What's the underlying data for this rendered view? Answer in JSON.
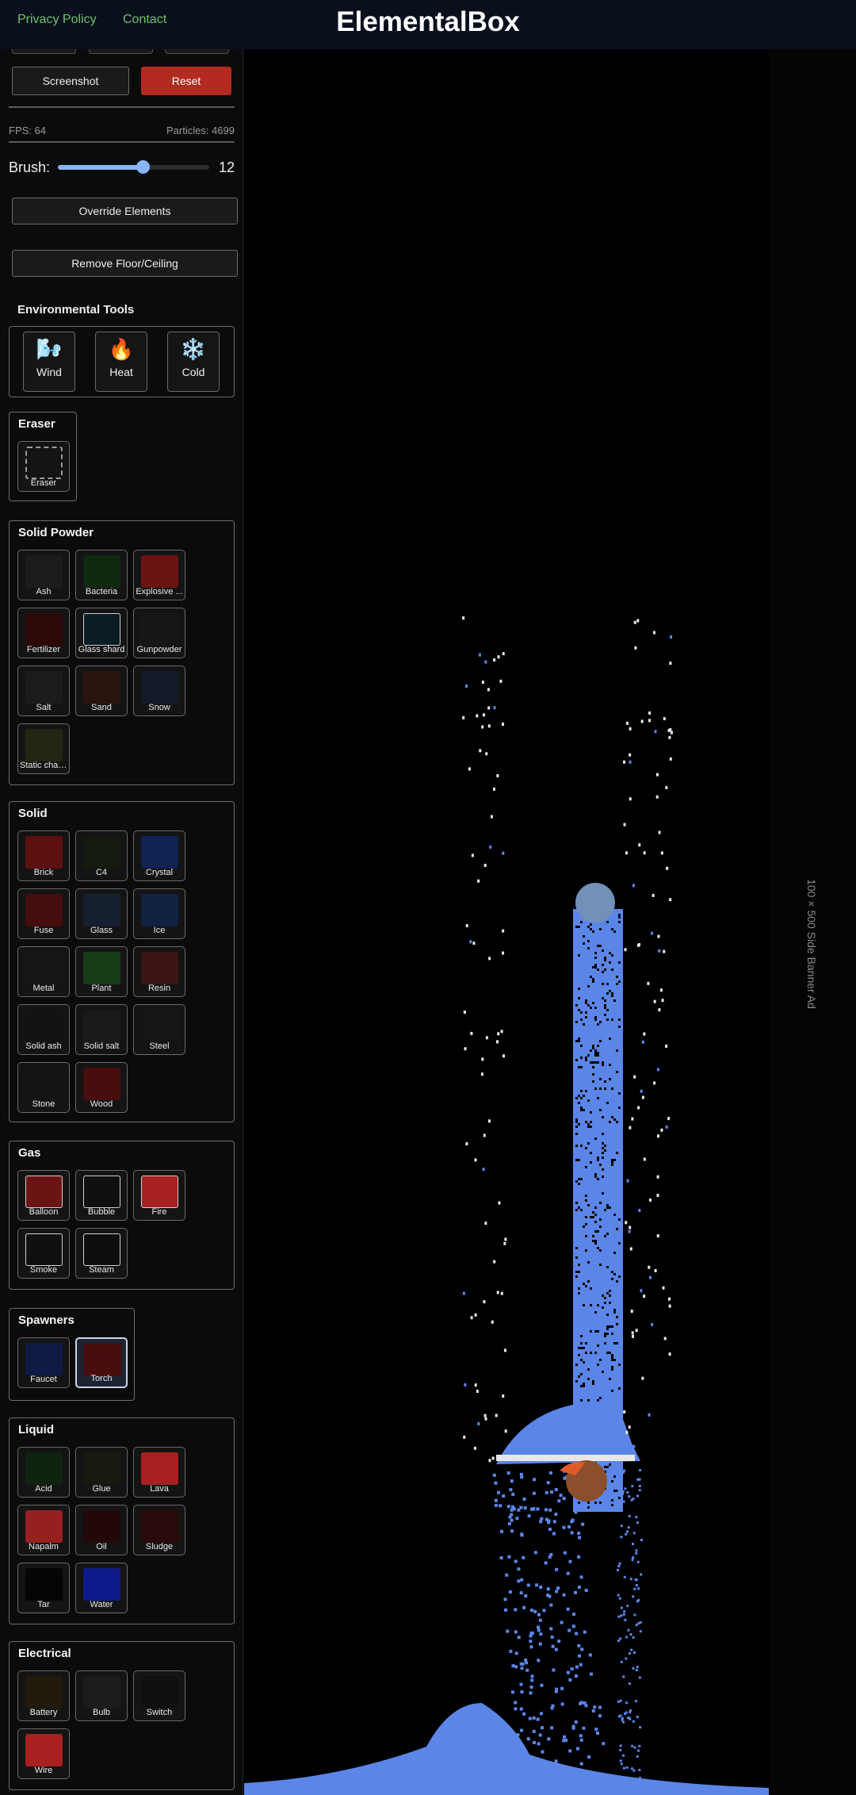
{
  "header": {
    "privacy": "Privacy Policy",
    "contact": "Contact",
    "title": "ElementalBox"
  },
  "controls": {
    "screenshot": "Screenshot",
    "reset": "Reset",
    "fps": "FPS: 64",
    "particles": "Particles: 4699",
    "brush_label": "Brush:",
    "brush_value": "12",
    "brush_level": 0.56,
    "override": "Override Elements",
    "remove_floor": "Remove Floor/Ceiling"
  },
  "environmental": {
    "title": "Environmental Tools",
    "tools": [
      {
        "icon": "wind-icon",
        "glyph": "🌬️",
        "label": "Wind"
      },
      {
        "icon": "fire-icon",
        "glyph": "🔥",
        "label": "Heat"
      },
      {
        "icon": "snowflake-icon",
        "glyph": "❄️",
        "label": "Cold"
      }
    ]
  },
  "sections": [
    {
      "title": "Eraser",
      "items": [
        {
          "label": "Eraser",
          "color": "transparent",
          "style": "dash"
        }
      ]
    },
    {
      "title": "Solid Powder",
      "items": [
        {
          "label": "Ash",
          "color": "#1c1c1c"
        },
        {
          "label": "Bacteria",
          "color": "#0f2a0f"
        },
        {
          "label": "Explosive ...",
          "color": "#6b1414"
        },
        {
          "label": "Fertilizer",
          "color": "#2e0808"
        },
        {
          "label": "Glass shard",
          "color": "#0a1c24",
          "style": "outl"
        },
        {
          "label": "Gunpowder",
          "color": "#161616"
        },
        {
          "label": "Salt",
          "color": "#1c1c1c"
        },
        {
          "label": "Sand",
          "color": "#2a140e"
        },
        {
          "label": "Snow",
          "color": "#141a2a"
        },
        {
          "label": "Static char...",
          "color": "#252515"
        }
      ]
    },
    {
      "title": "Solid",
      "items": [
        {
          "label": "Brick",
          "color": "#5c1010"
        },
        {
          "label": "C4",
          "color": "#151a0f"
        },
        {
          "label": "Crystal",
          "color": "#0f2250"
        },
        {
          "label": "Fuse",
          "color": "#450d0d"
        },
        {
          "label": "Glass",
          "color": "#152030"
        },
        {
          "label": "Ice",
          "color": "#0f2242"
        },
        {
          "label": "Metal",
          "color": "#151515"
        },
        {
          "label": "Plant",
          "color": "#173d17"
        },
        {
          "label": "Resin",
          "color": "#3d1414"
        },
        {
          "label": "Solid ash",
          "color": "#121212"
        },
        {
          "label": "Solid salt",
          "color": "#1a1a1a"
        },
        {
          "label": "Steel",
          "color": "#151515"
        },
        {
          "label": "Stone",
          "color": "#141414"
        },
        {
          "label": "Wood",
          "color": "#4a0d0d"
        }
      ]
    },
    {
      "title": "Gas",
      "items": [
        {
          "label": "Balloon",
          "color": "#6b1414",
          "style": "outl"
        },
        {
          "label": "Bubble",
          "color": "#101010",
          "style": "outl"
        },
        {
          "label": "Fire",
          "color": "#a82020",
          "style": "outl"
        },
        {
          "label": "Smoke",
          "color": "#101010",
          "style": "outl"
        },
        {
          "label": "Steam",
          "color": "#0e0e0e",
          "style": "outl"
        }
      ]
    },
    {
      "title": "Spawners",
      "items": [
        {
          "label": "Faucet",
          "color": "#0f1a45"
        },
        {
          "label": "Torch",
          "color": "#4a0d0d",
          "selected": true
        }
      ]
    },
    {
      "title": "Liquid",
      "items": [
        {
          "label": "Acid",
          "color": "#0f2410"
        },
        {
          "label": "Glue",
          "color": "#161a0f"
        },
        {
          "label": "Lava",
          "color": "#a82020"
        },
        {
          "label": "Napalm",
          "color": "#962020"
        },
        {
          "label": "Oil",
          "color": "#220808"
        },
        {
          "label": "Sludge",
          "color": "#2a0a0a"
        },
        {
          "label": "Tar",
          "color": "#050505"
        },
        {
          "label": "Water",
          "color": "#0f1a8a"
        }
      ]
    },
    {
      "title": "Electrical",
      "items": [
        {
          "label": "Battery",
          "color": "#221a0d"
        },
        {
          "label": "Bulb",
          "color": "#1c1c1c"
        },
        {
          "label": "Switch",
          "color": "#101010"
        },
        {
          "label": "Wire",
          "color": "#a82020"
        }
      ]
    }
  ],
  "simulation": {
    "colors": {
      "water": "#5b86e8",
      "steam": "#e8e8e8",
      "stone": "#7390b8",
      "wood": "#8b4f2c",
      "fire": "#e05a2a"
    }
  },
  "ad": {
    "text": "100 × 500 Side Banner Ad"
  }
}
